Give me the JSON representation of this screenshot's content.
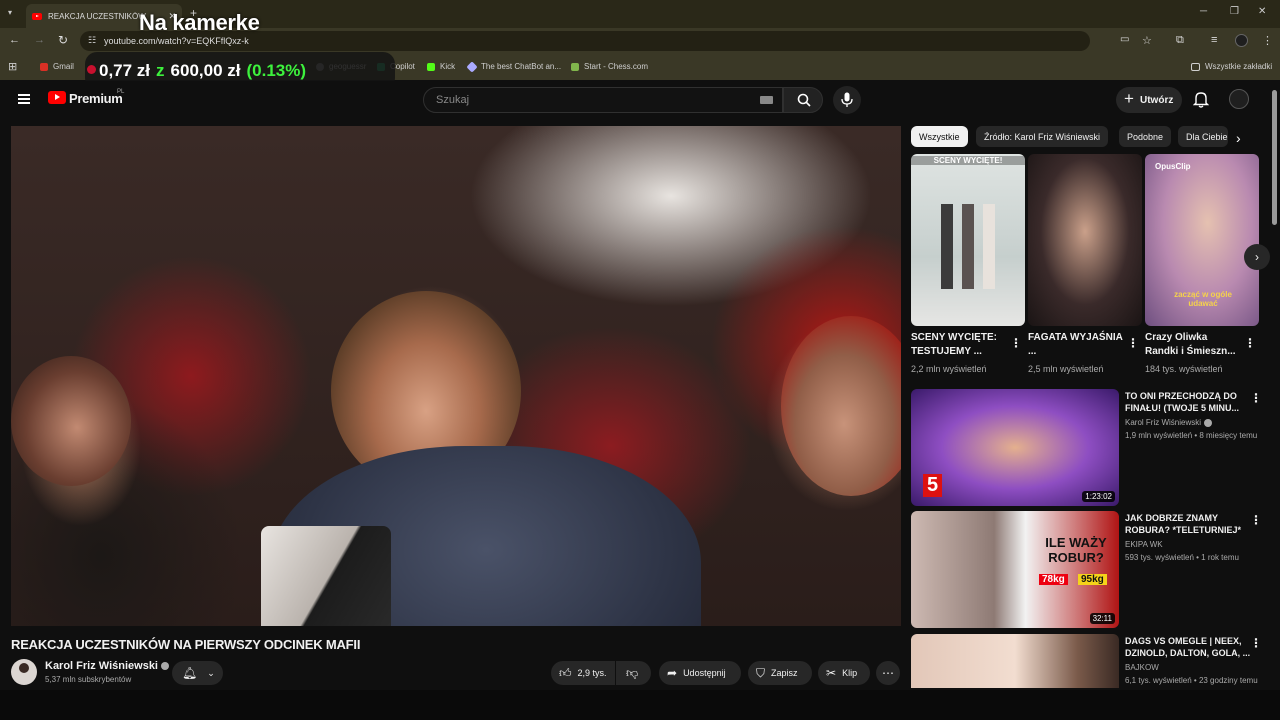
{
  "browser": {
    "tab_title": "REAKCJA UCZESTNIKÓW N",
    "url": "youtube.com/watch?v=EQKFflQxz-k",
    "bookmarks": [
      {
        "label": "Gmail",
        "color": "#d93025"
      },
      {
        "label": "geoguessr",
        "color": "#8a8a8a"
      },
      {
        "label": "Copilot",
        "color": "#2bb673"
      },
      {
        "label": "Kick",
        "color": "#53fc18"
      },
      {
        "label": "The best ChatBot an...",
        "color": "#aaaaff"
      },
      {
        "label": "Start - Chess.com",
        "color": "#81b64c"
      }
    ],
    "all_bookmarks": "Wszystkie zakładki"
  },
  "overlay": {
    "title": "Na kamerke",
    "amount": "0,77 zł",
    "of": "z",
    "goal": "600,00 zł",
    "percent": "(0.13%)"
  },
  "header": {
    "logo_text": "Premium",
    "region": "PL",
    "search_placeholder": "Szukaj",
    "create_label": "Utwórz"
  },
  "video": {
    "title": "REAKCJA UCZESTNIKÓW NA PIERWSZY ODCINEK MAFII",
    "channel": "Karol Friz Wiśniewski",
    "subscribers": "5,37 mln subskrybentów",
    "likes": "2,9 tys.",
    "share": "Udostępnij",
    "save": "Zapisz",
    "clip": "Klip"
  },
  "chips": [
    "Wszystkie",
    "Źródło: Karol Friz Wiśniewski",
    "Podobne",
    "Dla Ciebie"
  ],
  "shorts": [
    {
      "title": "SCENY WYCIĘTE: TESTUJEMY ...",
      "views": "2,2 mln wyświetleń",
      "overlay": "SCENY WYCIĘTE!"
    },
    {
      "title": "FAGATA WYJAŚNIA ...",
      "views": "2,5 mln wyświetleń",
      "overlay": ""
    },
    {
      "title": "Crazy Oliwka Randki i Śmieszn...",
      "views": "184 tys. wyświetleń",
      "overlay": "zacząć w ogóle udawać"
    }
  ],
  "shorts_badge": "OpusClip",
  "related": [
    {
      "title": "TO ONI PRZECHODZĄ DO FINAŁU! (TWOJE 5 MINU...",
      "channel": "Karol Friz Wiśniewski",
      "meta": "1,9 mln wyświetleń • 8 miesięcy temu",
      "duration": "1:23:02",
      "thumb_text": "5"
    },
    {
      "title": "JAK DOBRZE ZNAMY ROBURA? *TELETURNIEJ*",
      "channel": "EKIPA WK",
      "meta": "593 tys. wyświetleń • 1 rok temu",
      "duration": "32:11",
      "thumb_text": "ILE WAŻY ROBUR?",
      "tag1": "78kg",
      "tag2": "95kg"
    },
    {
      "title": "DAGS VS OMEGLE | NEEX, DZINOLD, DALTON, GOLA, ...",
      "channel": "BAJKOW",
      "meta": "6,1 tys. wyświetleń • 23 godziny temu",
      "duration": "",
      "thumb_text": ""
    }
  ]
}
